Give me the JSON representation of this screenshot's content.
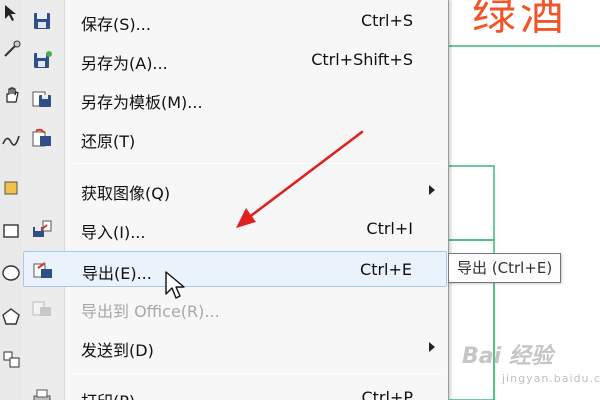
{
  "canvas": {
    "title_text": "绿酒"
  },
  "menu": {
    "items": [
      {
        "label": "保存(S)...",
        "shortcut": "Ctrl+S",
        "icon": "save-icon"
      },
      {
        "label": "另存为(A)...",
        "shortcut": "Ctrl+Shift+S",
        "icon": "save-as-icon"
      },
      {
        "label": "另存为模板(M)...",
        "shortcut": "",
        "icon": "save-template-icon"
      },
      {
        "label": "还原(T)",
        "shortcut": "",
        "icon": "revert-icon"
      },
      {
        "label": "获取图像(Q)",
        "shortcut": "",
        "icon": "",
        "submenu": true
      },
      {
        "label": "导入(I)...",
        "shortcut": "Ctrl+I",
        "icon": "import-icon"
      },
      {
        "label": "导出(E)...",
        "shortcut": "Ctrl+E",
        "icon": "export-icon",
        "highlighted": true
      },
      {
        "label": "导出到 Office(R)...",
        "shortcut": "",
        "icon": "export-office-icon",
        "disabled": true
      },
      {
        "label": "发送到(D)",
        "shortcut": "",
        "icon": "",
        "submenu": true
      },
      {
        "label": "打印(P)...",
        "shortcut": "Ctrl+P",
        "icon": "print-icon"
      }
    ]
  },
  "tooltip": {
    "text": "导出 (Ctrl+E)"
  },
  "watermark": {
    "text": "Bai 经验",
    "sub": "jingyan.baidu.com"
  },
  "colors": {
    "highlight": "#eaf2fb",
    "highlight_border": "#aac7e7",
    "annotation_arrow": "#e02020",
    "title_red": "#f0562a",
    "frame_green": "#3cb878"
  }
}
